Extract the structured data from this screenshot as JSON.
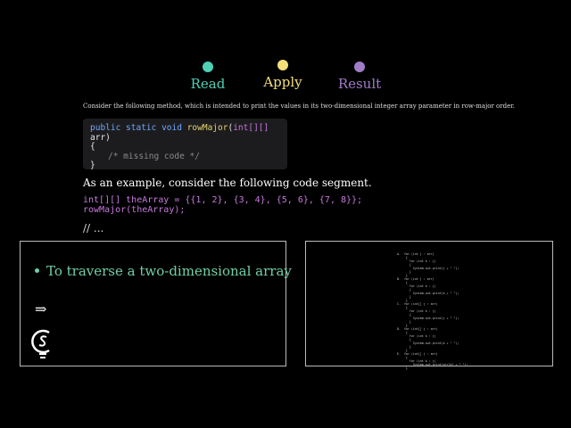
{
  "steps": [
    {
      "label": "Read",
      "color": "#4fd1b5"
    },
    {
      "label": "Apply",
      "color": "#f4e07a"
    },
    {
      "label": "Result",
      "color": "#a17cc7"
    }
  ],
  "question": {
    "intro": "Consider the following method, which is intended to print the values in its two-dimensional integer array parameter in row-major order.",
    "code": {
      "sig_kw": "public static void",
      "sig_name": "rowMajor",
      "sig_paren": "(",
      "sig_type": "int[][]",
      "sig_param": " arr)",
      "open": "{",
      "comment": "/* missing code */",
      "close": "}"
    },
    "example_text": "As an example, consider the following code segment.",
    "snippet": "int[][] theArray = {{1, 2}, {3, 4}, {5, 6}, {7, 8}};\nrowMajor(theArray);",
    "ellipsis": "// ..."
  },
  "left_panel": {
    "bullet": "To traverse a two-dimensional array",
    "arrow": "⇒"
  },
  "right_panel": {
    "choices_text": "A.  for (int j : arr)\n     {\n       for (int k : j)\n       {\n         System.out.print(j + \" \");\n       }\n     }\nB.  for (int j : arr)\n     {\n       for (int k : j)\n       {\n         System.out.print(k + \" \");\n       }\n     }\nC.  for (int[] j : arr)\n     {\n       for (int k : j)\n       {\n         System.out.print(j + \" \");\n       }\n     }\nD.  for (int[] j : arr)\n     {\n       for (int k : j)\n       {\n         System.out.print(k + \" \");\n       }\n     }\nE.  for (int[] j : arr)\n     {\n       for (int k : j)\n         System.out.print(arr[k] + \" \");\n     }"
  }
}
